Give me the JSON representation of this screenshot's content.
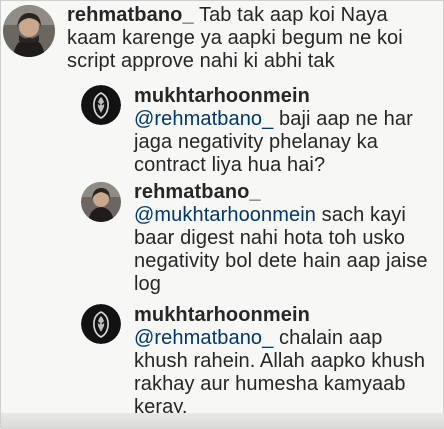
{
  "comments": [
    {
      "username": "rehmatbano_",
      "lines": [
        "Tab tak aap koi Naya",
        "kaam karenge ya aapki begum ne koi",
        "script approve nahi ki abhi tak"
      ],
      "avatar": "woman-portrait"
    }
  ],
  "replies": [
    {
      "username": "mukhtarhoonmein",
      "mention": "@rehmatbano_",
      "lines": [
        "baji aap ne har",
        "jaga negativity phelanay ka",
        "contract liya hua hai?"
      ],
      "avatar": "dark-mask-logo"
    },
    {
      "username": "rehmatbano_",
      "mention": "@mukhtarhoonmein",
      "lines": [
        "sach kayi",
        "baar digest nahi hota toh usko",
        "negativity bol dete hain aap jaise",
        "log"
      ],
      "avatar": "woman-portrait"
    },
    {
      "username": "mukhtarhoonmein",
      "mention": "@rehmatbano_",
      "lines": [
        "chalain aap",
        "khush rahein. Allah aapko khush",
        "rakhay aur humesha kamyaab",
        "keray."
      ],
      "avatar": "dark-mask-logo"
    }
  ],
  "colors": {
    "text": "#262626",
    "mention": "#00376b",
    "background": "#f7f7f5"
  }
}
